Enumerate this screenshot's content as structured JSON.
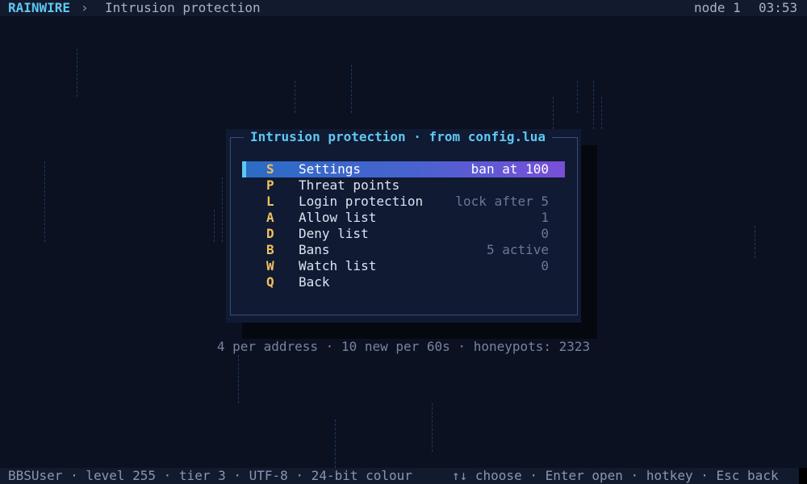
{
  "header": {
    "brand": "RAINWIRE",
    "separator": "›",
    "breadcrumb": "Intrusion protection",
    "node": "node 1",
    "clock": "03:53"
  },
  "dialog": {
    "title": "Intrusion protection · from config.lua",
    "items": [
      {
        "key": "S",
        "label": "Settings",
        "value": "ban at 100",
        "selected": true
      },
      {
        "key": "P",
        "label": "Threat points",
        "value": ""
      },
      {
        "key": "L",
        "label": "Login protection",
        "value": "lock after 5"
      },
      {
        "key": "A",
        "label": "Allow list",
        "value": "1"
      },
      {
        "key": "D",
        "label": "Deny list",
        "value": "0"
      },
      {
        "key": "B",
        "label": "Bans",
        "value": "5 active"
      },
      {
        "key": "W",
        "label": "Watch list",
        "value": "0"
      },
      {
        "key": "Q",
        "label": "Back",
        "value": ""
      }
    ]
  },
  "info_line": "4 per address · 10 new per 60s · honeypots: 2323",
  "statusbar": {
    "left": "BBSUser · level 255 · tier 3 · UTF-8 · 24-bit colour",
    "right": "↑↓ choose · Enter open · hotkey · Esc back"
  },
  "colors": {
    "background": "#0b1120",
    "accent": "#5ec8f2",
    "hotkey": "#f0c060",
    "selection_start": "#2a6cc4",
    "selection_end": "#7a4ed8"
  }
}
